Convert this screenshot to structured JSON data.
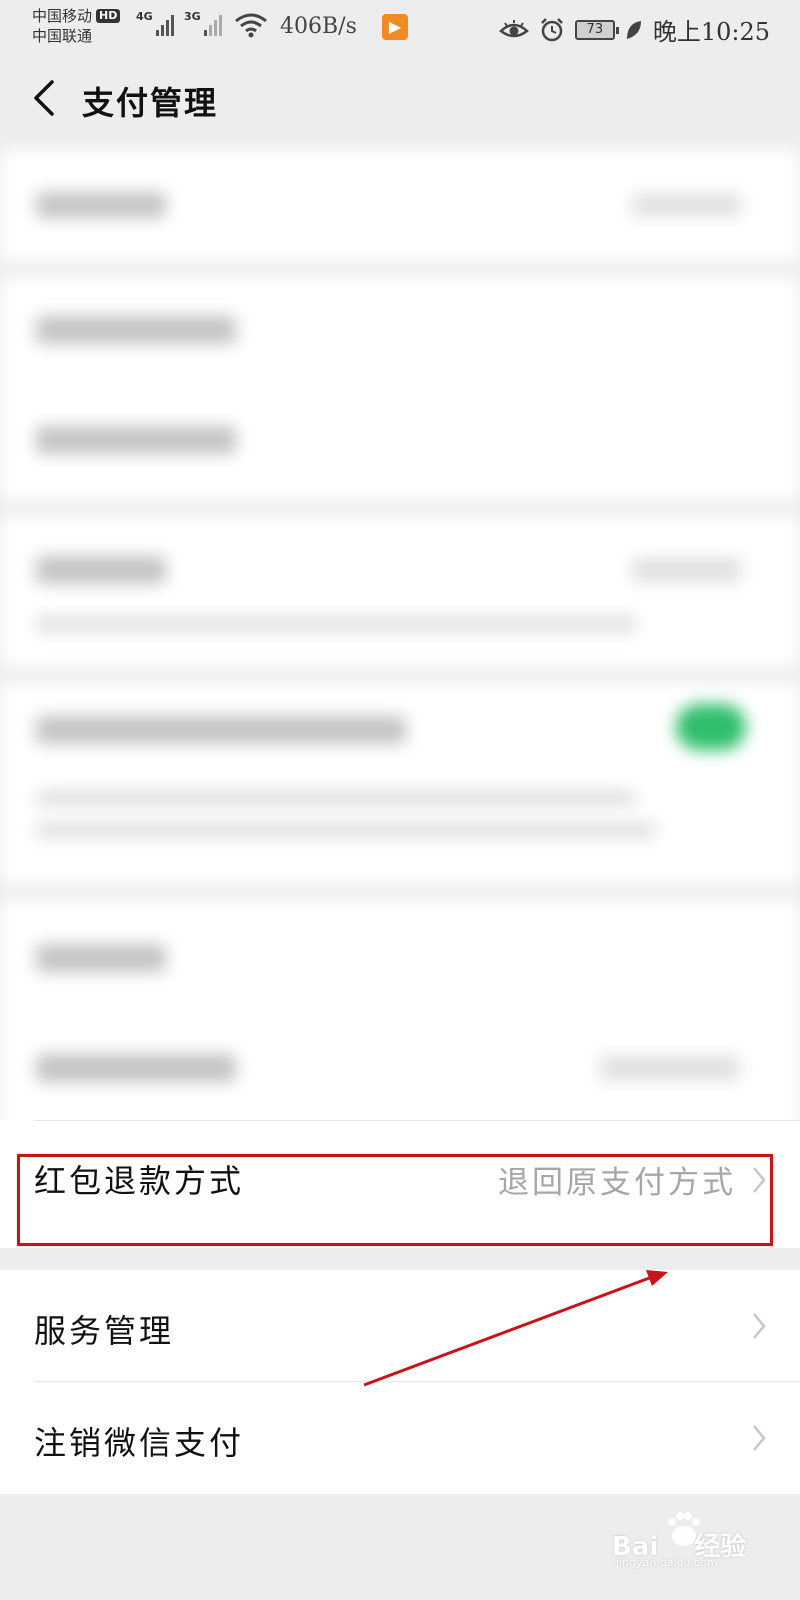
{
  "status_bar": {
    "carrier1": "中国移动",
    "carrier1_badge": "HD",
    "carrier2": "中国联通",
    "net1": "4G",
    "net2": "3G",
    "speed": "406B/s",
    "battery": "73",
    "time": "晚上10:25"
  },
  "header": {
    "title": "支付管理"
  },
  "settings": {
    "red_packet_refund": {
      "label": "红包退款方式",
      "value": "退回原支付方式"
    },
    "service_management": {
      "label": "服务管理"
    },
    "close_wechat_pay": {
      "label": "注销微信支付"
    }
  },
  "watermark": {
    "brand": "Bai",
    "brand_suffix": "经验",
    "domain": "jingyan.baidu.com"
  },
  "colors": {
    "page_bg": "#ededed",
    "card_bg": "#ffffff",
    "highlight_red": "#c8151b",
    "toggle_green": "#2fbf6b",
    "value_gray": "#a6a6a6"
  }
}
